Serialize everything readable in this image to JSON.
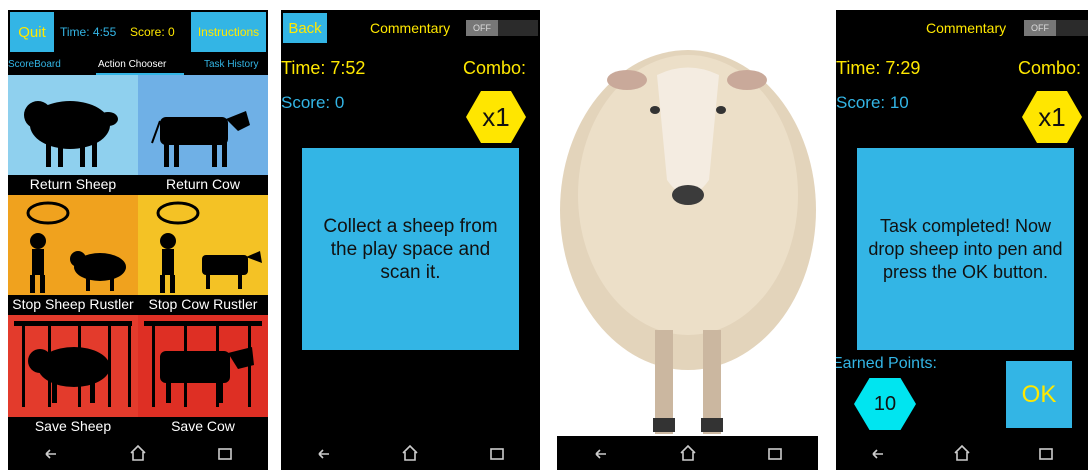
{
  "screen1": {
    "quit_label": "Quit",
    "time_text": "Time: 4:55",
    "score_text": "Score: 0",
    "instructions_label": "Instructions",
    "tabs": [
      "ScoreBoard",
      "Action Chooser",
      "Task History"
    ],
    "tiles": [
      {
        "label": "Return Sheep",
        "bg": "#8fd0ee"
      },
      {
        "label": "Return Cow",
        "bg": "#6fb0e6"
      },
      {
        "label": "Stop Sheep Rustler",
        "bg": "#f0a21e"
      },
      {
        "label": "Stop Cow Rustler",
        "bg": "#f4c225"
      },
      {
        "label": "Save Sheep",
        "bg": "#e33b2c"
      },
      {
        "label": "Save Cow",
        "bg": "#de2f24"
      }
    ]
  },
  "screen2": {
    "back_label": "Back",
    "commentary_label": "Commentary",
    "toggle_state": "OFF",
    "time_text": "Time: 7:52",
    "combo_label": "Combo:",
    "score_text": "Score: 0",
    "multiplier": "x1",
    "message": "Collect a sheep from the play space and scan it."
  },
  "screen4": {
    "commentary_label": "Commentary",
    "toggle_state": "OFF",
    "time_text": "Time: 7:29",
    "combo_label": "Combo:",
    "score_text": "Score: 10",
    "multiplier": "x1",
    "message": "Task completed! Now drop sheep into pen and press the OK button.",
    "earned_label": "Earned Points:",
    "earned_value": "10",
    "ok_label": "OK"
  },
  "colors": {
    "accent_cyan": "#33b5e5",
    "label_yellow": "#ffe800",
    "hex_yellow": "#ffe600",
    "hex_cyan": "#00e5f0"
  }
}
